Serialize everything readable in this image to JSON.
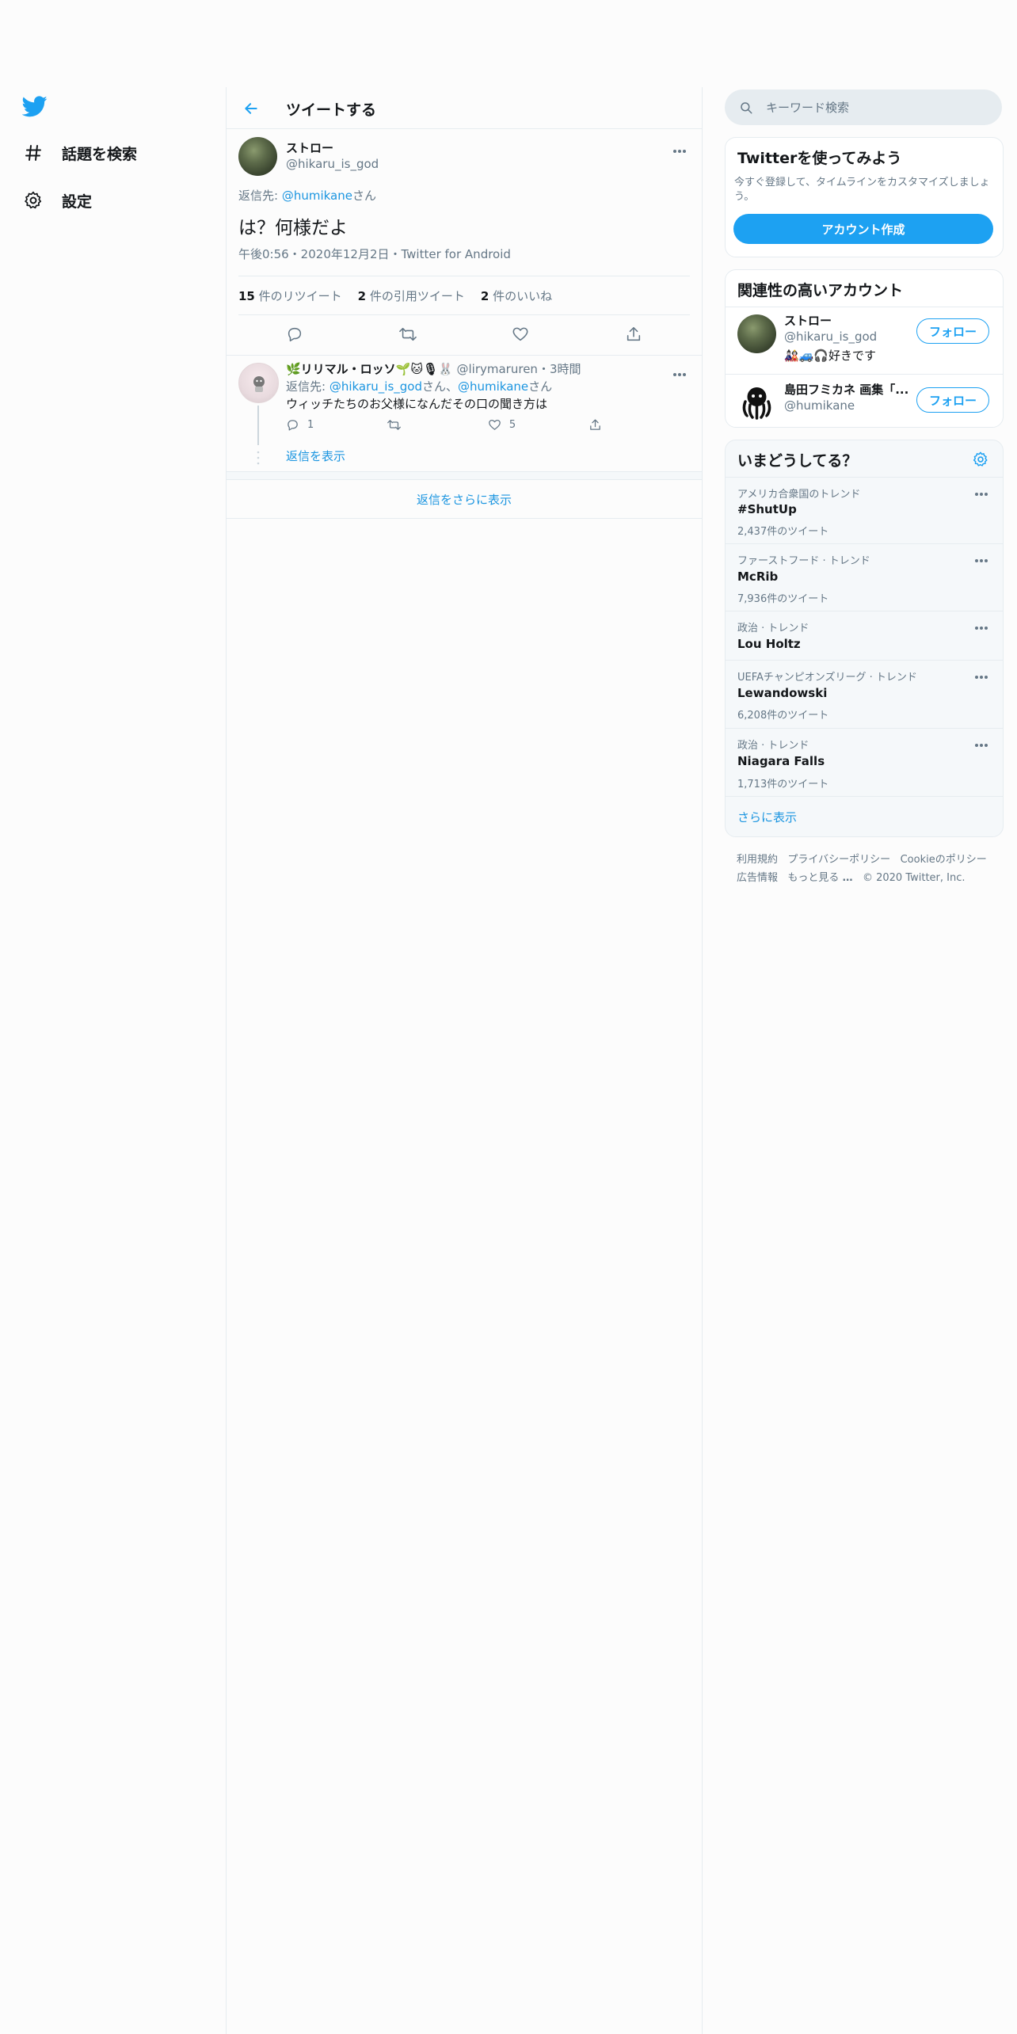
{
  "nav": {
    "logo": "twitter-bird-icon",
    "items": [
      {
        "label": "話題を検索",
        "icon": "hashtag-icon"
      },
      {
        "label": "設定",
        "icon": "gear-icon"
      }
    ]
  },
  "header": {
    "title": "ツイートする"
  },
  "tweet": {
    "name": "ストロー",
    "handle": "@hikaru_is_god",
    "reply_prefix": "返信先: ",
    "reply_to": "@humikane",
    "reply_suffix": "さん",
    "text": "は？何様だよ",
    "meta": "午後0:56・2020年12月2日・Twitter for Android",
    "stats": {
      "retweets_count": "15",
      "retweets_label": " 件のリツイート",
      "quotes_count": "2",
      "quotes_label": " 件の引用ツイート",
      "likes_count": "2",
      "likes_label": " 件のいいね"
    }
  },
  "reply": {
    "name": "🌿リリマル・ロッソ🌱🐱🎙🐰",
    "handle": "@lirymaruren",
    "time": "・3時間",
    "reply_prefix": "返信先: ",
    "reply_to_1": "@hikaru_is_god",
    "reply_mid": "さん、",
    "reply_to_2": "@humikane",
    "reply_suffix": "さん",
    "text": "ウィッチたちのお父様になんだその口の聞き方は",
    "reply_count": "1",
    "like_count": "5",
    "show_replies": "返信を表示"
  },
  "more_replies": "返信をさらに表示",
  "search": {
    "placeholder": "キーワード検索"
  },
  "signup": {
    "title": "Twitterを使ってみよう",
    "desc_line1": "今すぐ登録して、タイムラインをカスタマイズしましょ",
    "desc_line2": "う。",
    "button": "アカウント作成"
  },
  "relevant": {
    "title": "関連性の高いアカウント",
    "accounts": [
      {
        "name": "ストロー",
        "handle": "@hikaru_is_god",
        "bio": "🎎🚙🎧好きです",
        "follow": "フォロー"
      },
      {
        "name": "島田フミカネ 画集「...",
        "handle": "@humikane",
        "follow": "フォロー"
      }
    ]
  },
  "trends": {
    "title": "いまどうしてる？",
    "items": [
      {
        "meta": "アメリカ合衆国のトレンド",
        "name": "#ShutUp",
        "count": "2,437件のツイート"
      },
      {
        "meta": "ファーストフード · トレンド",
        "name": "McRib",
        "count": "7,936件のツイート"
      },
      {
        "meta": "政治 · トレンド",
        "name": "Lou Holtz",
        "count": ""
      },
      {
        "meta": "UEFAチャンピオンズリーグ · トレンド",
        "name": "Lewandowski",
        "count": "6,208件のツイート"
      },
      {
        "meta": "政治 · トレンド",
        "name": "Niagara Falls",
        "count": "1,713件のツイート"
      }
    ],
    "show_more": "さらに表示"
  },
  "footer": {
    "terms": "利用規約",
    "privacy": "プライバシーポリシー",
    "cookie": "Cookieのポリシー",
    "ads": "広告情報",
    "more": "もっと見る",
    "copyright": "© 2020 Twitter, Inc."
  },
  "colors": {
    "accent": "#1da1f2",
    "link": "#1b95e0",
    "muted": "#657786",
    "border": "#e6ecf0"
  }
}
